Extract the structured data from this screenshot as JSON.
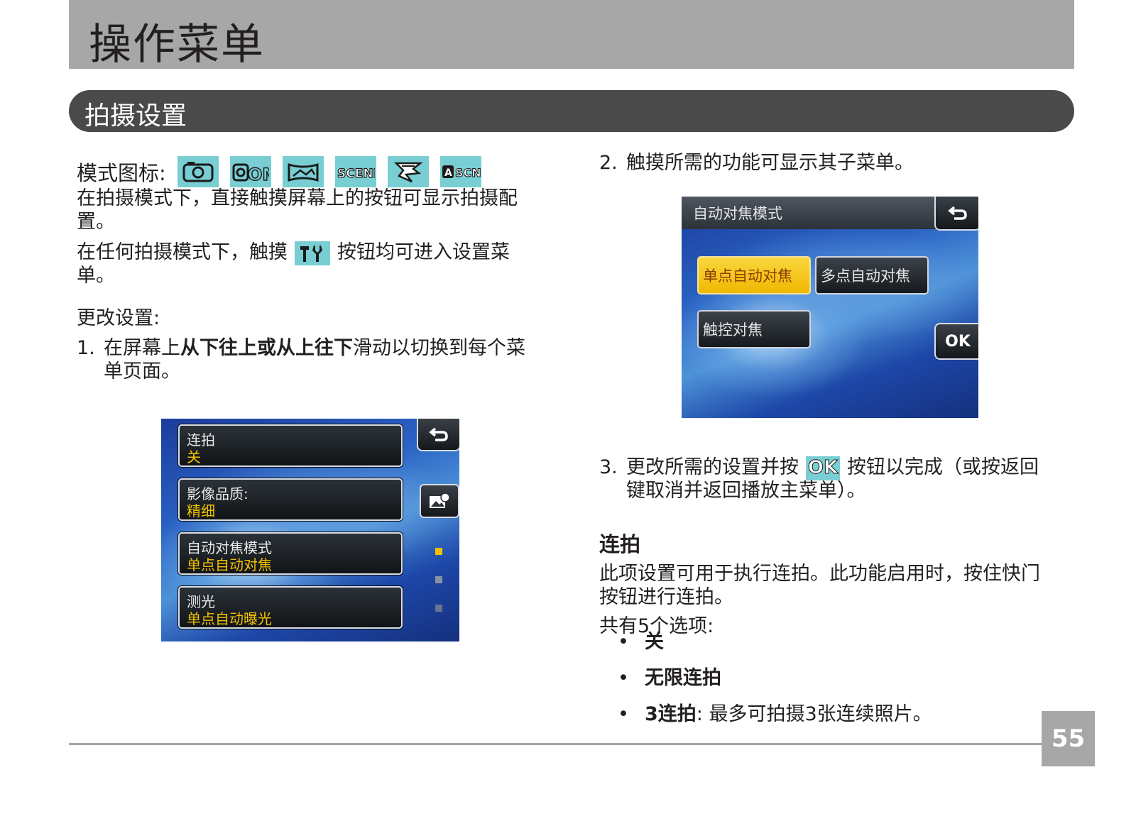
{
  "header": {
    "title": "操作菜单"
  },
  "section": {
    "title": "拍摄设置"
  },
  "left": {
    "mode_label": "模式图标:",
    "mode_icons": [
      "camera-icon",
      "camera-manual-icon",
      "panorama-icon",
      "scene-icon",
      "antishake-icon",
      "auto-scene-icon"
    ],
    "icon_text": {
      "om": "OM",
      "scene": "SCENE",
      "asn_a": "A",
      "asn_scn": "SCN"
    },
    "para1_line1": "在拍摄模式下，直接触摸屏幕上的按钮可显示拍摄配",
    "para1_line2": "置。",
    "para2_before": "在任何拍摄模式下，触摸",
    "para2_after": "按钮均可进入设置菜",
    "para2_line2": "单。",
    "change_settings": "更改设置:",
    "step1_num": "1.",
    "step1_pre": "在屏幕上",
    "step1_bold": "从下往上或从上往下",
    "step1_post": "滑动以切换到每个菜",
    "step1_line2": "单页面。"
  },
  "menu_screen": {
    "items": [
      {
        "label": "连拍",
        "value": "关"
      },
      {
        "label": "影像品质:",
        "value": "精细"
      },
      {
        "label": "自动对焦模式",
        "value": "单点自动对焦"
      },
      {
        "label": "测光",
        "value": "单点自动曝光"
      }
    ]
  },
  "right": {
    "step2_num": "2.",
    "step2_text": "触摸所需的功能可显示其子菜单。",
    "step3_num": "3.",
    "step3_before": "更改所需的设置并按",
    "step3_ok": "OK",
    "step3_after": "按钮以完成（或按返回",
    "step3_line2": "键取消并返回播放主菜单）。",
    "burst_heading": "连拍",
    "burst_desc_line1": "此项设置可用于执行连拍。此功能启用时，按住快门",
    "burst_desc_line2": "按钮进行连拍。",
    "options_intro": "共有5个选项:",
    "options": [
      {
        "bold": "关",
        "rest": ""
      },
      {
        "bold": "无限连拍",
        "rest": ""
      },
      {
        "bold": "3连拍",
        "rest": ":  最多可拍摄3张连续照片。"
      }
    ]
  },
  "af_screen": {
    "title": "自动对焦模式",
    "options": [
      "单点自动对焦",
      "多点自动对焦",
      "触控对焦"
    ],
    "ok_label": "OK"
  },
  "footer": {
    "page_number": "55"
  },
  "colors": {
    "header_bg": "#a7a7a7",
    "section_bg": "#4a4a4a",
    "icon_bg": "#79ced3",
    "selected_option": "#f2c200"
  }
}
